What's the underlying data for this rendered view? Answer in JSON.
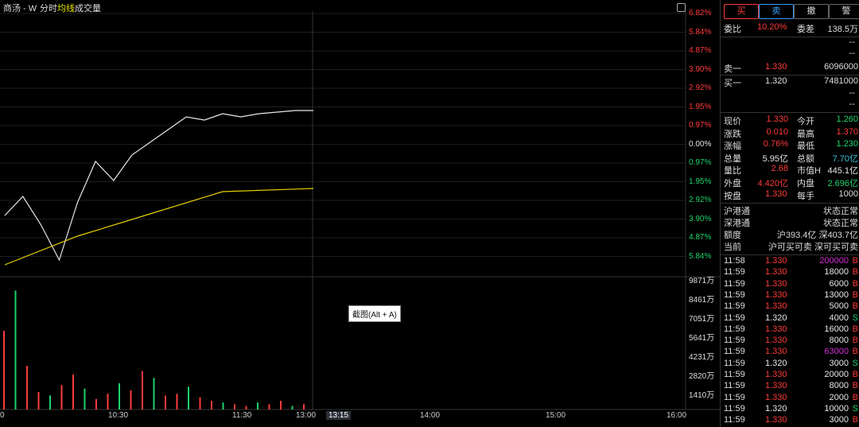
{
  "header": {
    "title": "商汤 - W",
    "tab_fenshi": "分时",
    "tab_junxian": "均线",
    "tab_volume": "成交量"
  },
  "price_axis": {
    "labels": [
      "6.82%",
      "5.84%",
      "4.87%",
      "3.90%",
      "2.92%",
      "1.95%",
      "0.97%",
      "0.00%",
      "0.97%",
      "1.95%",
      "2.92%",
      "3.90%",
      "4.87%",
      "5.84%"
    ],
    "colors": [
      "#ff3b3b",
      "#ff3b3b",
      "#ff3b3b",
      "#ff3b3b",
      "#ff3b3b",
      "#ff3b3b",
      "#ff3b3b",
      "#e6e6e6",
      "#1dd36b",
      "#1dd36b",
      "#1dd36b",
      "#1dd36b",
      "#1dd36b",
      "#1dd36b"
    ]
  },
  "volume_axis": {
    "labels": [
      "9871万",
      "8461万",
      "7051万",
      "5641万",
      "4231万",
      "2820万",
      "1410万"
    ]
  },
  "time_axis": {
    "labels": [
      "0",
      "10:30",
      "11:30",
      "13:00",
      "13:15",
      "14:00",
      "15:00",
      "16:00"
    ]
  },
  "tooltip": "截图(Alt + A)",
  "chart_data": {
    "type": "line",
    "price_series": [
      {
        "x": 0,
        "y": 4.2
      },
      {
        "x": 1,
        "y": 3.6
      },
      {
        "x": 2,
        "y": 4.5
      },
      {
        "x": 3,
        "y": 5.6
      },
      {
        "x": 4,
        "y": 3.8
      },
      {
        "x": 5,
        "y": 2.5
      },
      {
        "x": 6,
        "y": 3.1
      },
      {
        "x": 7,
        "y": 2.3
      },
      {
        "x": 8,
        "y": 1.9
      },
      {
        "x": 9,
        "y": 1.5
      },
      {
        "x": 10,
        "y": 1.1
      },
      {
        "x": 11,
        "y": 1.2
      },
      {
        "x": 12,
        "y": 1.0
      },
      {
        "x": 13,
        "y": 1.1
      },
      {
        "x": 14,
        "y": 1.0
      },
      {
        "x": 15,
        "y": 0.95
      },
      {
        "x": 16,
        "y": 0.9
      },
      {
        "x": 17,
        "y": 0.9
      }
    ],
    "avg_series": [
      {
        "x": 0,
        "y": 4.2
      },
      {
        "x": 4,
        "y": 3.3
      },
      {
        "x": 8,
        "y": 2.6
      },
      {
        "x": 12,
        "y": 1.9
      },
      {
        "x": 17,
        "y": 1.8
      }
    ],
    "volume_bars": [
      45,
      68,
      25,
      10,
      8,
      14,
      20,
      12,
      6,
      9,
      15,
      11,
      22,
      18,
      8,
      9,
      13,
      7,
      5,
      4,
      3,
      2,
      4,
      3,
      5,
      2,
      3
    ]
  },
  "panel": {
    "buttons": [
      {
        "label": "买",
        "color": "#ff3b3b"
      },
      {
        "label": "卖",
        "color": "#39a0ff"
      },
      {
        "label": "撤",
        "color": "#dddddd"
      },
      {
        "label": "警",
        "color": "#dddddd"
      }
    ],
    "order_stats": {
      "weibi_label": "委比",
      "weibi_value": "10.20%",
      "weicha_label": "委差",
      "weicha_value": "138.5万"
    },
    "dash1": "--",
    "dash2": "--",
    "sell1": {
      "label": "卖一",
      "price": "1.330",
      "qty": "6096000"
    },
    "buy1": {
      "label": "买一",
      "price": "1.320",
      "qty": "7481000"
    },
    "dash3": "--",
    "dash4": "--",
    "quote_rows": [
      {
        "l1": "现价",
        "v1": "1.330",
        "c1": "red",
        "l2": "今开",
        "v2": "1.260",
        "c2": "green"
      },
      {
        "l1": "涨跌",
        "v1": "0.010",
        "c1": "red",
        "l2": "最高",
        "v2": "1.370",
        "c2": "red"
      },
      {
        "l1": "涨幅",
        "v1": "0.76%",
        "c1": "red",
        "l2": "最低",
        "v2": "1.230",
        "c2": "green"
      },
      {
        "l1": "总量",
        "v1": "5.95亿",
        "c1": "white",
        "l2": "总额",
        "v2": "7.70亿",
        "c2": "cyan"
      },
      {
        "l1": "量比",
        "v1": "2.68",
        "c1": "red",
        "l2": "市值H",
        "v2": "445.1亿",
        "c2": "white"
      },
      {
        "l1": "外盘",
        "v1": "4.420亿",
        "c1": "red",
        "l2": "内盘",
        "v2": "2.696亿",
        "c2": "green"
      }
    ],
    "anpan": {
      "l1": "按盘",
      "v1": "1.330",
      "l2": "每手",
      "v2": "1000"
    },
    "connect_rows": [
      {
        "label": "沪港通",
        "value": "状态正常"
      },
      {
        "label": "深港通",
        "value": "状态正常"
      },
      {
        "label": "额度",
        "value": "沪393.4亿 深403.7亿"
      },
      {
        "label": "当前",
        "value": "沪可买可卖 深可买可卖"
      }
    ],
    "trades": [
      {
        "time": "11:58",
        "price": "1.330",
        "pc": "red",
        "qty": "200000",
        "qc": "magenta",
        "side": "B",
        "sc": "red"
      },
      {
        "time": "11:59",
        "price": "1.330",
        "pc": "red",
        "qty": "18000",
        "qc": "white",
        "side": "B",
        "sc": "red"
      },
      {
        "time": "11:59",
        "price": "1.330",
        "pc": "red",
        "qty": "6000",
        "qc": "white",
        "side": "B",
        "sc": "red"
      },
      {
        "time": "11:59",
        "price": "1.330",
        "pc": "red",
        "qty": "13000",
        "qc": "white",
        "side": "B",
        "sc": "red"
      },
      {
        "time": "11:59",
        "price": "1.330",
        "pc": "red",
        "qty": "5000",
        "qc": "white",
        "side": "B",
        "sc": "red"
      },
      {
        "time": "11:59",
        "price": "1.320",
        "pc": "white",
        "qty": "4000",
        "qc": "white",
        "side": "S",
        "sc": "green"
      },
      {
        "time": "11:59",
        "price": "1.330",
        "pc": "red",
        "qty": "16000",
        "qc": "white",
        "side": "B",
        "sc": "red"
      },
      {
        "time": "11:59",
        "price": "1.330",
        "pc": "red",
        "qty": "8000",
        "qc": "white",
        "side": "B",
        "sc": "red"
      },
      {
        "time": "11:59",
        "price": "1.330",
        "pc": "red",
        "qty": "63000",
        "qc": "magenta",
        "side": "B",
        "sc": "red"
      },
      {
        "time": "11:59",
        "price": "1.320",
        "pc": "white",
        "qty": "3000",
        "qc": "white",
        "side": "S",
        "sc": "green"
      },
      {
        "time": "11:59",
        "price": "1.330",
        "pc": "red",
        "qty": "20000",
        "qc": "white",
        "side": "B",
        "sc": "red"
      },
      {
        "time": "11:59",
        "price": "1.330",
        "pc": "red",
        "qty": "8000",
        "qc": "white",
        "side": "B",
        "sc": "red"
      },
      {
        "time": "11:59",
        "price": "1.330",
        "pc": "red",
        "qty": "2000",
        "qc": "white",
        "side": "B",
        "sc": "red"
      },
      {
        "time": "11:59",
        "price": "1.320",
        "pc": "white",
        "qty": "10000",
        "qc": "white",
        "side": "S",
        "sc": "green"
      },
      {
        "time": "11:59",
        "price": "1.330",
        "pc": "red",
        "qty": "3000",
        "qc": "white",
        "side": "B",
        "sc": "red"
      }
    ]
  }
}
